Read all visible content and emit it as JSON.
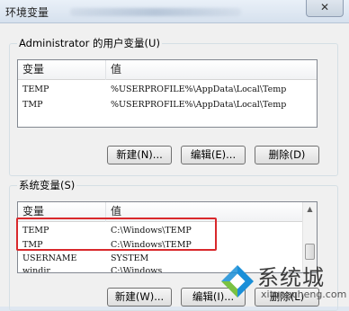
{
  "window": {
    "title": "环境变量",
    "close_glyph": "✕"
  },
  "user_vars": {
    "group_label": "Administrator 的用户变量(U)",
    "col_variable": "变量",
    "col_value": "值",
    "rows": [
      {
        "name": "TEMP",
        "value": "%USERPROFILE%\\AppData\\Local\\Temp"
      },
      {
        "name": "TMP",
        "value": "%USERPROFILE%\\AppData\\Local\\Temp"
      }
    ],
    "buttons": {
      "new": "新建(N)...",
      "edit": "编辑(E)...",
      "delete": "删除(D)"
    }
  },
  "system_vars": {
    "group_label": "系统变量(S)",
    "col_variable": "变量",
    "col_value": "值",
    "rows": [
      {
        "name": "TEMP",
        "value": "C:\\Windows\\TEMP"
      },
      {
        "name": "TMP",
        "value": "C:\\Windows\\TEMP"
      },
      {
        "name": "USERNAME",
        "value": "SYSTEM"
      },
      {
        "name": "windir",
        "value": "C:\\Windows"
      }
    ],
    "buttons": {
      "new": "新建(W)...",
      "edit": "编辑(I)...",
      "delete": "删除(L)"
    }
  },
  "watermark": {
    "text": "系统城",
    "url": "xitongcheng.com",
    "colors": {
      "blue": "#1a8fd8",
      "green": "#7ac143",
      "gray": "#3b3b3b"
    }
  },
  "accent_colors": {
    "highlight_border": "#d9282c"
  }
}
